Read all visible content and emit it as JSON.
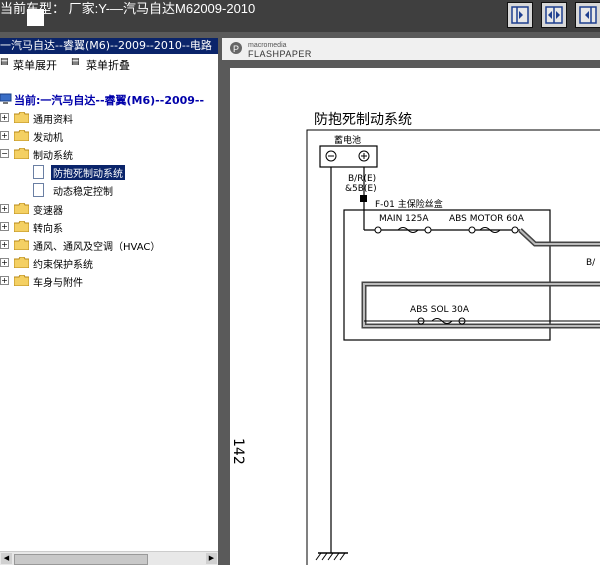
{
  "window": {
    "title": "当前车型： 厂家:Y-—汽马自达M62009-2010"
  },
  "toolbar": {
    "buttons": [
      "split-left",
      "split-center",
      "split-right"
    ]
  },
  "sidebar": {
    "header": "一汽马自达--睿翼(M6)--2009--2010--电路",
    "menu_expand": "菜单展开",
    "menu_collapse": "菜单折叠",
    "root": "当前:一汽马自达--睿翼(M6)--2009--",
    "items": [
      {
        "label": "通用资料"
      },
      {
        "label": "发动机"
      },
      {
        "label": "制动系统",
        "children": [
          {
            "label": "防抱死制动系统"
          },
          {
            "label": "动态稳定控制"
          }
        ]
      },
      {
        "label": "变速器"
      },
      {
        "label": "转向系"
      },
      {
        "label": "通风、通风及空调（HVAC）"
      },
      {
        "label": "约束保护系统"
      },
      {
        "label": "车身与附件"
      }
    ]
  },
  "viewer": {
    "brand_small": "macromedia",
    "brand_big": "FLASHPAPER"
  },
  "document": {
    "title": "防抱死制动系统",
    "page_number": "142",
    "battery_label": "蓄电池",
    "wire_label_1": "B/R(E)",
    "wire_label_2": "&5B(E)",
    "fusebox_label": "F-01 主保险丝盒",
    "fuse_main": "MAIN 125A",
    "fuse_abs_motor": "ABS MOTOR 60A",
    "fuse_abs_sol": "ABS SOL 30A",
    "edge_label": "B/"
  },
  "colors": {
    "selection": "#0a246a",
    "background": "#5a5a5a"
  }
}
